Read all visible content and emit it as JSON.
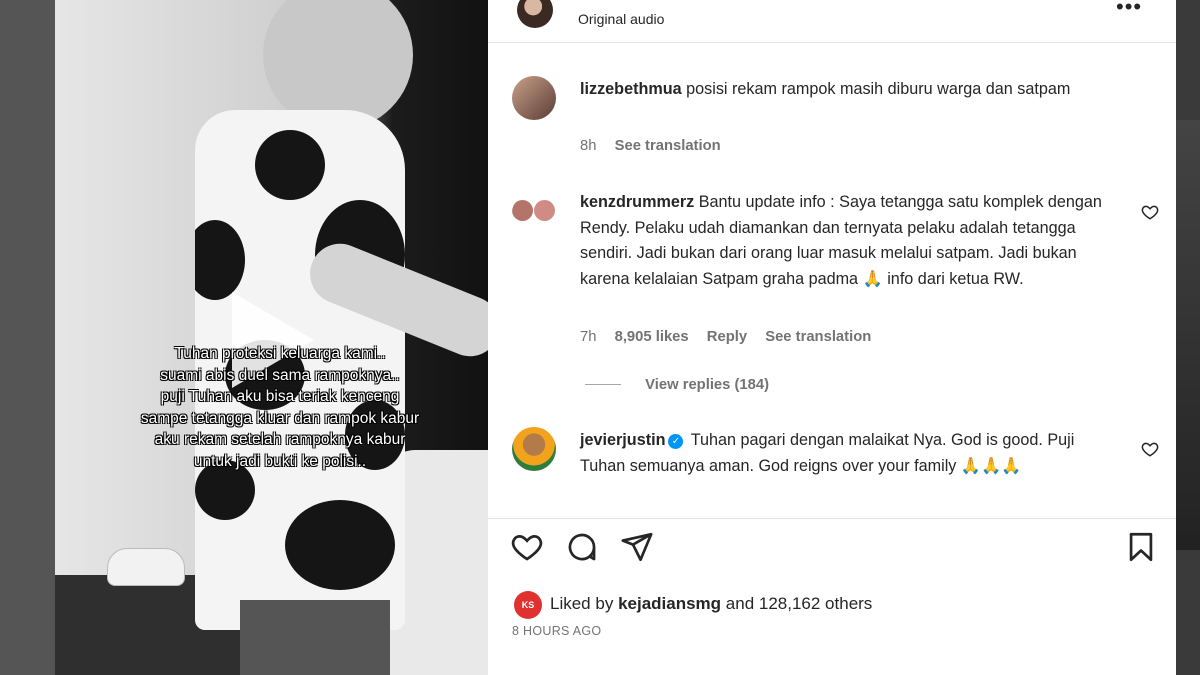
{
  "video": {
    "caption_lines": [
      "Tuhan proteksi keluarga kami..",
      "suami abis duel sama rampoknya..",
      "puji Tuhan aku bisa teriak kenceng",
      "sampe tetangga kluar dan rampok kabur",
      "aku rekam setelah rampoknya kabur",
      "untuk jadi bukti ke polisi.."
    ],
    "play_icon": "play-icon"
  },
  "header": {
    "audio_label": "Original audio",
    "more_icon": "more-horizontal-icon"
  },
  "comments": [
    {
      "user": "lizzebethmua",
      "text": "posisi rekam rampok masih diburu warga dan satpam",
      "time": "8h",
      "translate": "See translation"
    },
    {
      "user": "kenzdrummerz",
      "text": "Bantu update info : Saya tetangga satu komplek dengan Rendy. Pelaku udah diamankan dan ternyata pelaku adalah tetangga sendiri. Jadi bukan dari orang luar masuk melalui satpam. Jadi bukan karena kelalaian Satpam graha padma 🙏 info dari ketua RW.",
      "time": "7h",
      "likes": "8,905 likes",
      "reply": "Reply",
      "translate": "See translation",
      "view_replies": "View replies (184)"
    },
    {
      "user": "jevierjustin",
      "text": "Tuhan pagari dengan malaikat Nya. God is good. Puji Tuhan semuanya aman. God reigns over your family 🙏🙏🙏",
      "verified": true
    }
  ],
  "liked_by": {
    "prefix": "Liked by",
    "user": "kejadiansmg",
    "suffix": "and 128,162 others",
    "avatar_text": "KS"
  },
  "timestamp": "8 HOURS AGO",
  "colors": {
    "text": "#262626",
    "secondary": "#737373",
    "verified": "#0095f6"
  }
}
